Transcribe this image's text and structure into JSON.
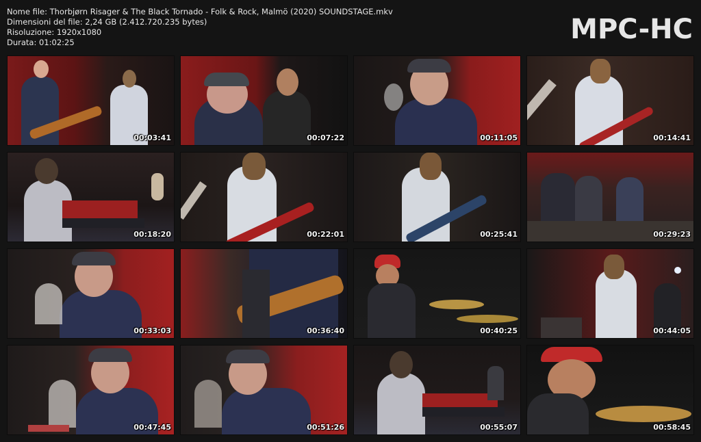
{
  "file_info": {
    "name_line": "Nome file: Thorbjørn Risager & The Black Tornado - Folk & Rock, Malmö (2020) SOUNDSTAGE.mkv",
    "size_line": "Dimensioni del file: 2,24 GB (2.412.720.235 bytes)",
    "resolution_line": "Risoluzione: 1920x1080",
    "duration_line": "Durata: 01:02:25"
  },
  "logo": "MPC-HC",
  "thumbnails": [
    {
      "time": "00:03:41",
      "scene": "two-guitarists-red-curtain"
    },
    {
      "time": "00:07:22",
      "scene": "singer-and-guitarist-closeup"
    },
    {
      "time": "00:11:05",
      "scene": "singer-at-microphone"
    },
    {
      "time": "00:14:41",
      "scene": "guitarist-white-shirt"
    },
    {
      "time": "00:18:20",
      "scene": "keyboard-player"
    },
    {
      "time": "00:22:01",
      "scene": "guitarist-red-guitar"
    },
    {
      "time": "00:25:41",
      "scene": "guitarist-blue-guitar"
    },
    {
      "time": "00:29:23",
      "scene": "full-band-wide-shot"
    },
    {
      "time": "00:33:03",
      "scene": "singer-at-microphone"
    },
    {
      "time": "00:36:40",
      "scene": "guitar-closeup"
    },
    {
      "time": "00:40:25",
      "scene": "drummer-red-hat"
    },
    {
      "time": "00:44:05",
      "scene": "stage-wide-shot"
    },
    {
      "time": "00:47:45",
      "scene": "singer-at-microphone"
    },
    {
      "time": "00:51:26",
      "scene": "singer-at-microphone"
    },
    {
      "time": "00:55:07",
      "scene": "keyboard-player-wide"
    },
    {
      "time": "00:58:45",
      "scene": "drummer-red-hat-closeup"
    }
  ]
}
